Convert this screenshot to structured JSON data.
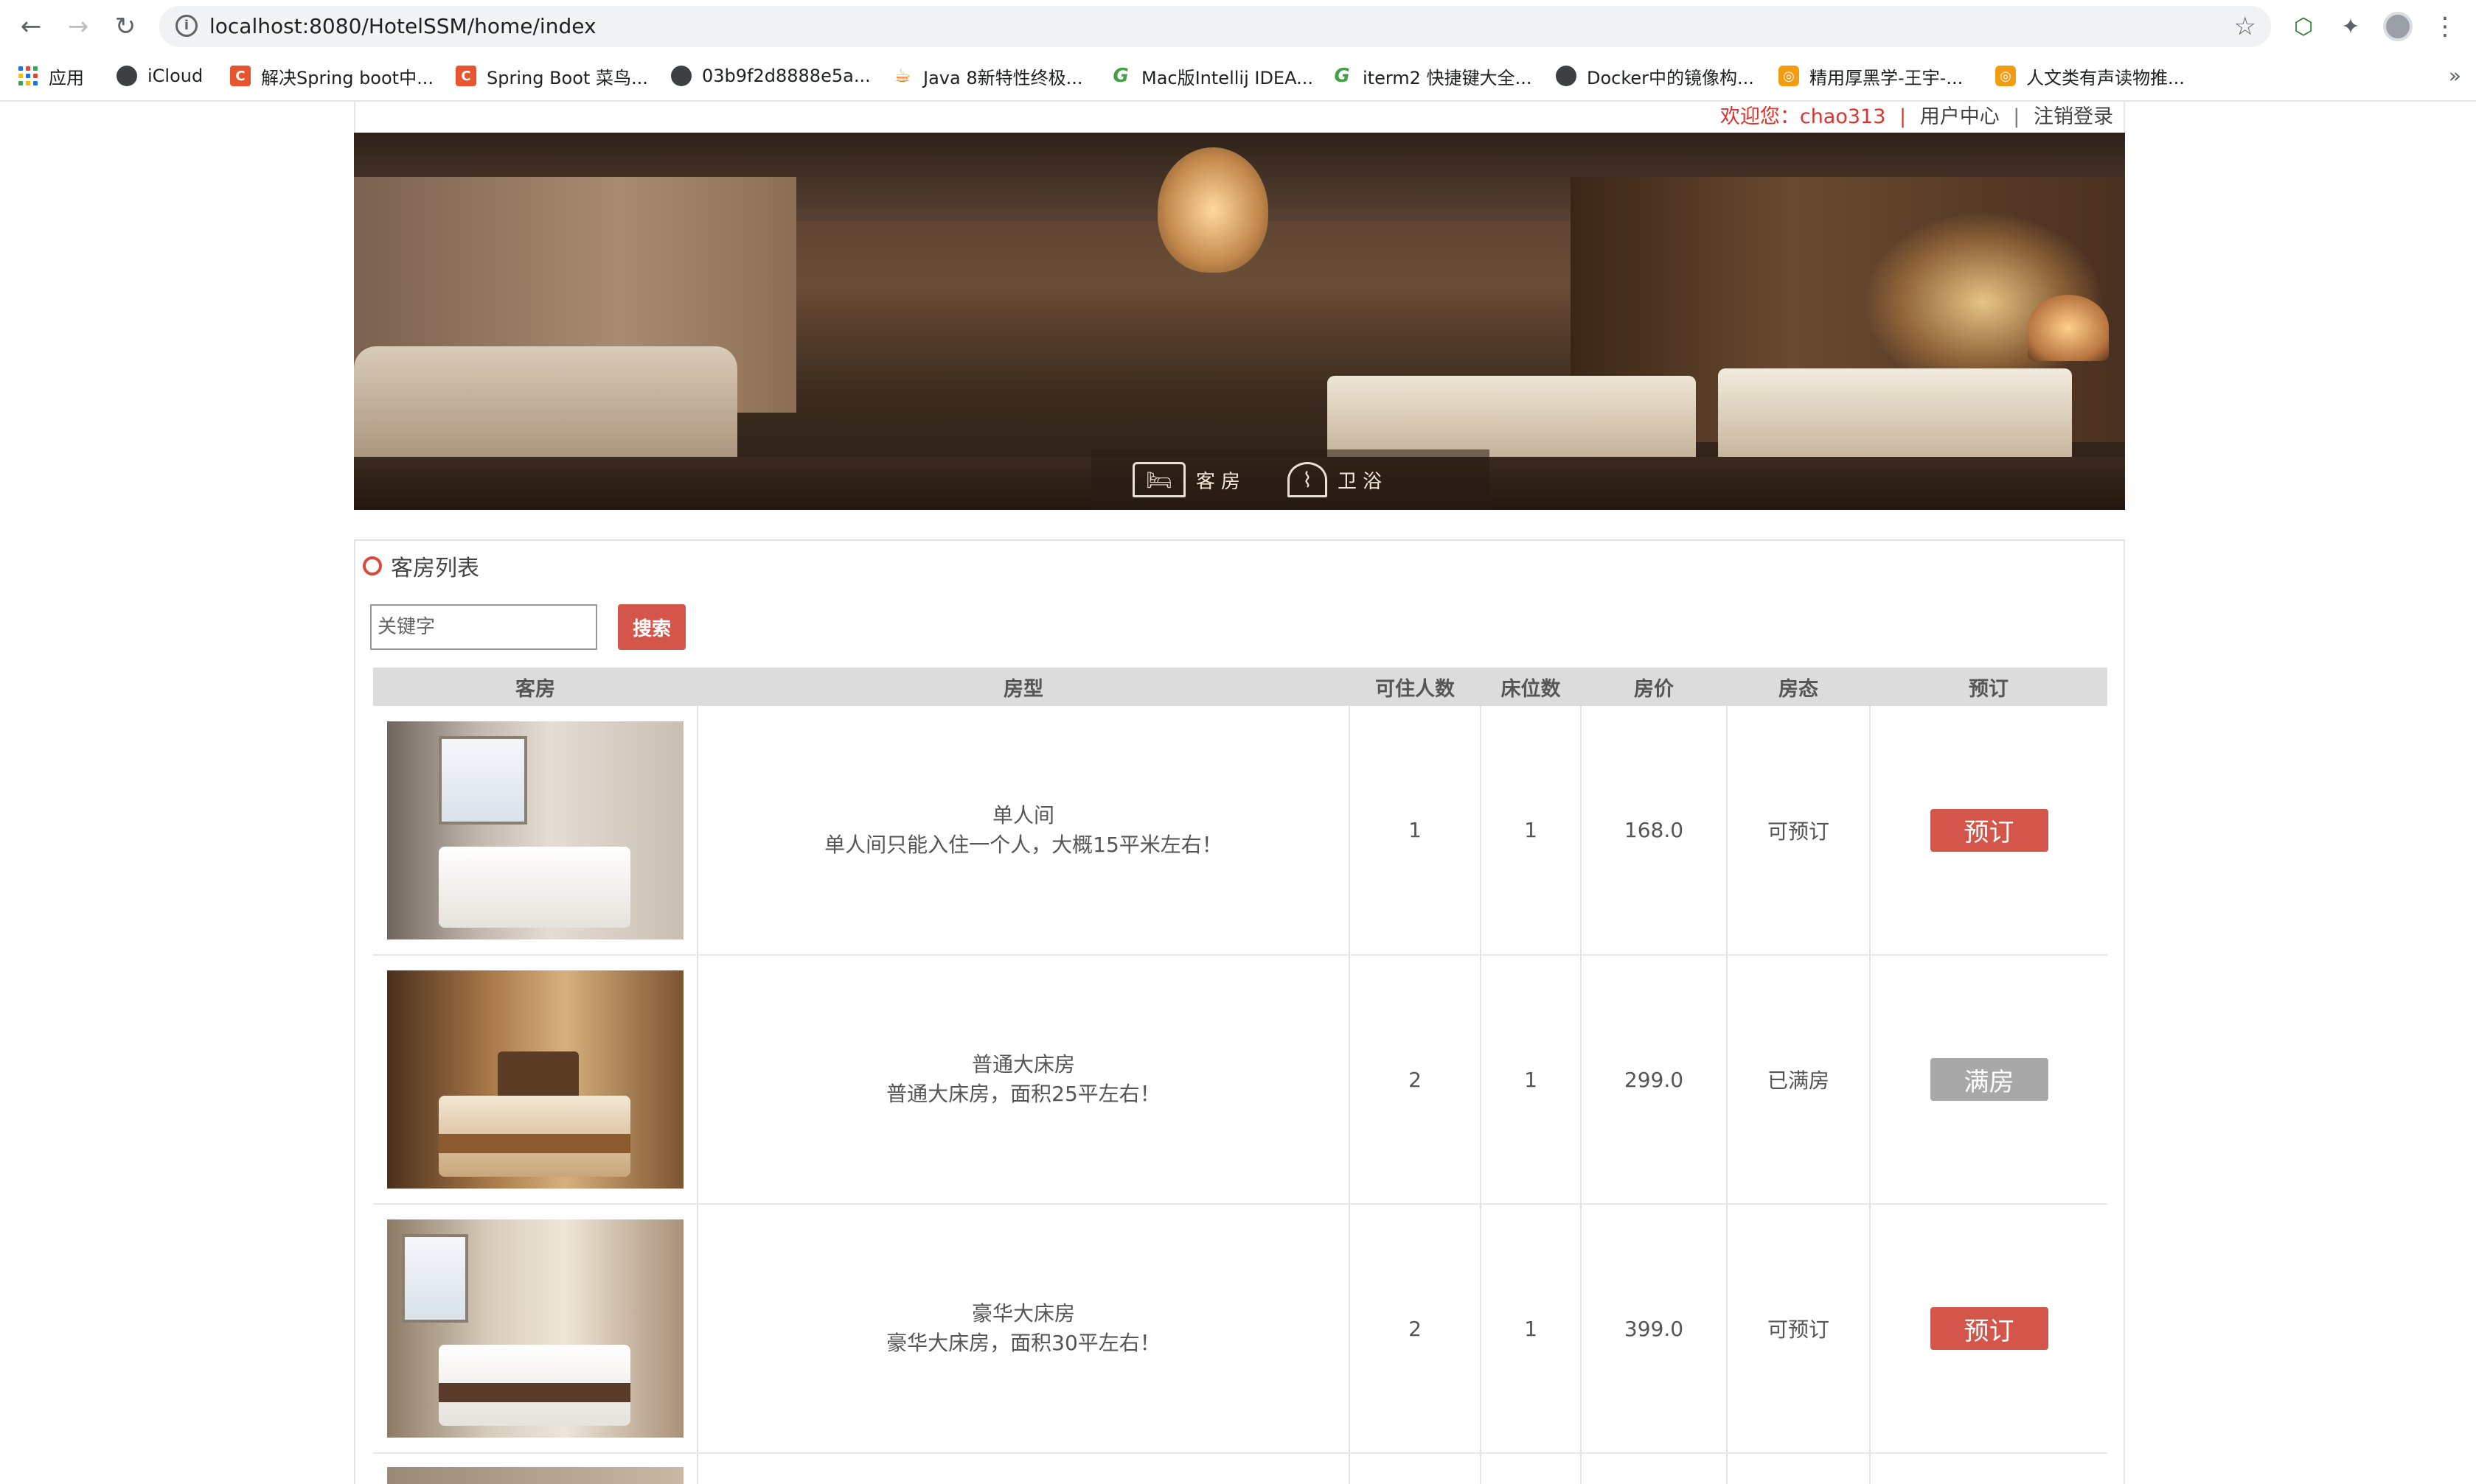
{
  "browser": {
    "url_host": "localhost",
    "url_rest": ":8080/HotelSSM/home/index",
    "bookmarks": [
      {
        "label": "应用",
        "icon": "apps-grid-icon"
      },
      {
        "label": "iCloud",
        "icon": "globe-icon"
      },
      {
        "label": "解决Spring boot中...",
        "icon": "csdn-icon"
      },
      {
        "label": "Spring Boot 菜鸟...",
        "icon": "csdn-icon"
      },
      {
        "label": "03b9f2d8888e5a...",
        "icon": "globe-icon"
      },
      {
        "label": "Java 8新特性终极...",
        "icon": "java-icon"
      },
      {
        "label": "Mac版Intellij IDEA...",
        "icon": "g-icon"
      },
      {
        "label": "iterm2 快捷键大全...",
        "icon": "g-icon"
      },
      {
        "label": "Docker中的镜像构...",
        "icon": "globe-icon"
      },
      {
        "label": "精用厚黑学-王宇-...",
        "icon": "geek-icon"
      },
      {
        "label": "人文类有声读物推...",
        "icon": "geek-icon"
      }
    ],
    "more": "»"
  },
  "header": {
    "welcome_label": "欢迎您：",
    "username": "chao313",
    "separator": "|",
    "user_center": "用户中心",
    "logout": "注销登录"
  },
  "banner": {
    "tabs": [
      {
        "label": "客房",
        "icon": "bed-icon"
      },
      {
        "label": "卫浴",
        "icon": "shower-icon"
      }
    ]
  },
  "room_list": {
    "title": "客房列表",
    "search_placeholder": "关键字",
    "search_button": "搜索",
    "columns": [
      "客房",
      "房型",
      "可住人数",
      "床位数",
      "房价",
      "房态",
      "预订"
    ],
    "rooms": [
      {
        "name": "单人间",
        "description": "单人间只能入住一个人，大概15平米左右！",
        "capacity": "1",
        "beds": "1",
        "price": "168.0",
        "status": "可预订",
        "action": "预订",
        "available": true
      },
      {
        "name": "普通大床房",
        "description": "普通大床房，面积25平左右！",
        "capacity": "2",
        "beds": "1",
        "price": "299.0",
        "status": "已满房",
        "action": "满房",
        "available": false
      },
      {
        "name": "豪华大床房",
        "description": "豪华大床房，面积30平左右！",
        "capacity": "2",
        "beds": "1",
        "price": "399.0",
        "status": "可预订",
        "action": "预订",
        "available": true
      }
    ]
  },
  "colors": {
    "accent": "#d4554a",
    "welcome_red": "#e0312c",
    "full_gray": "#a8a8a8",
    "header_gray": "#dcdcdc"
  }
}
